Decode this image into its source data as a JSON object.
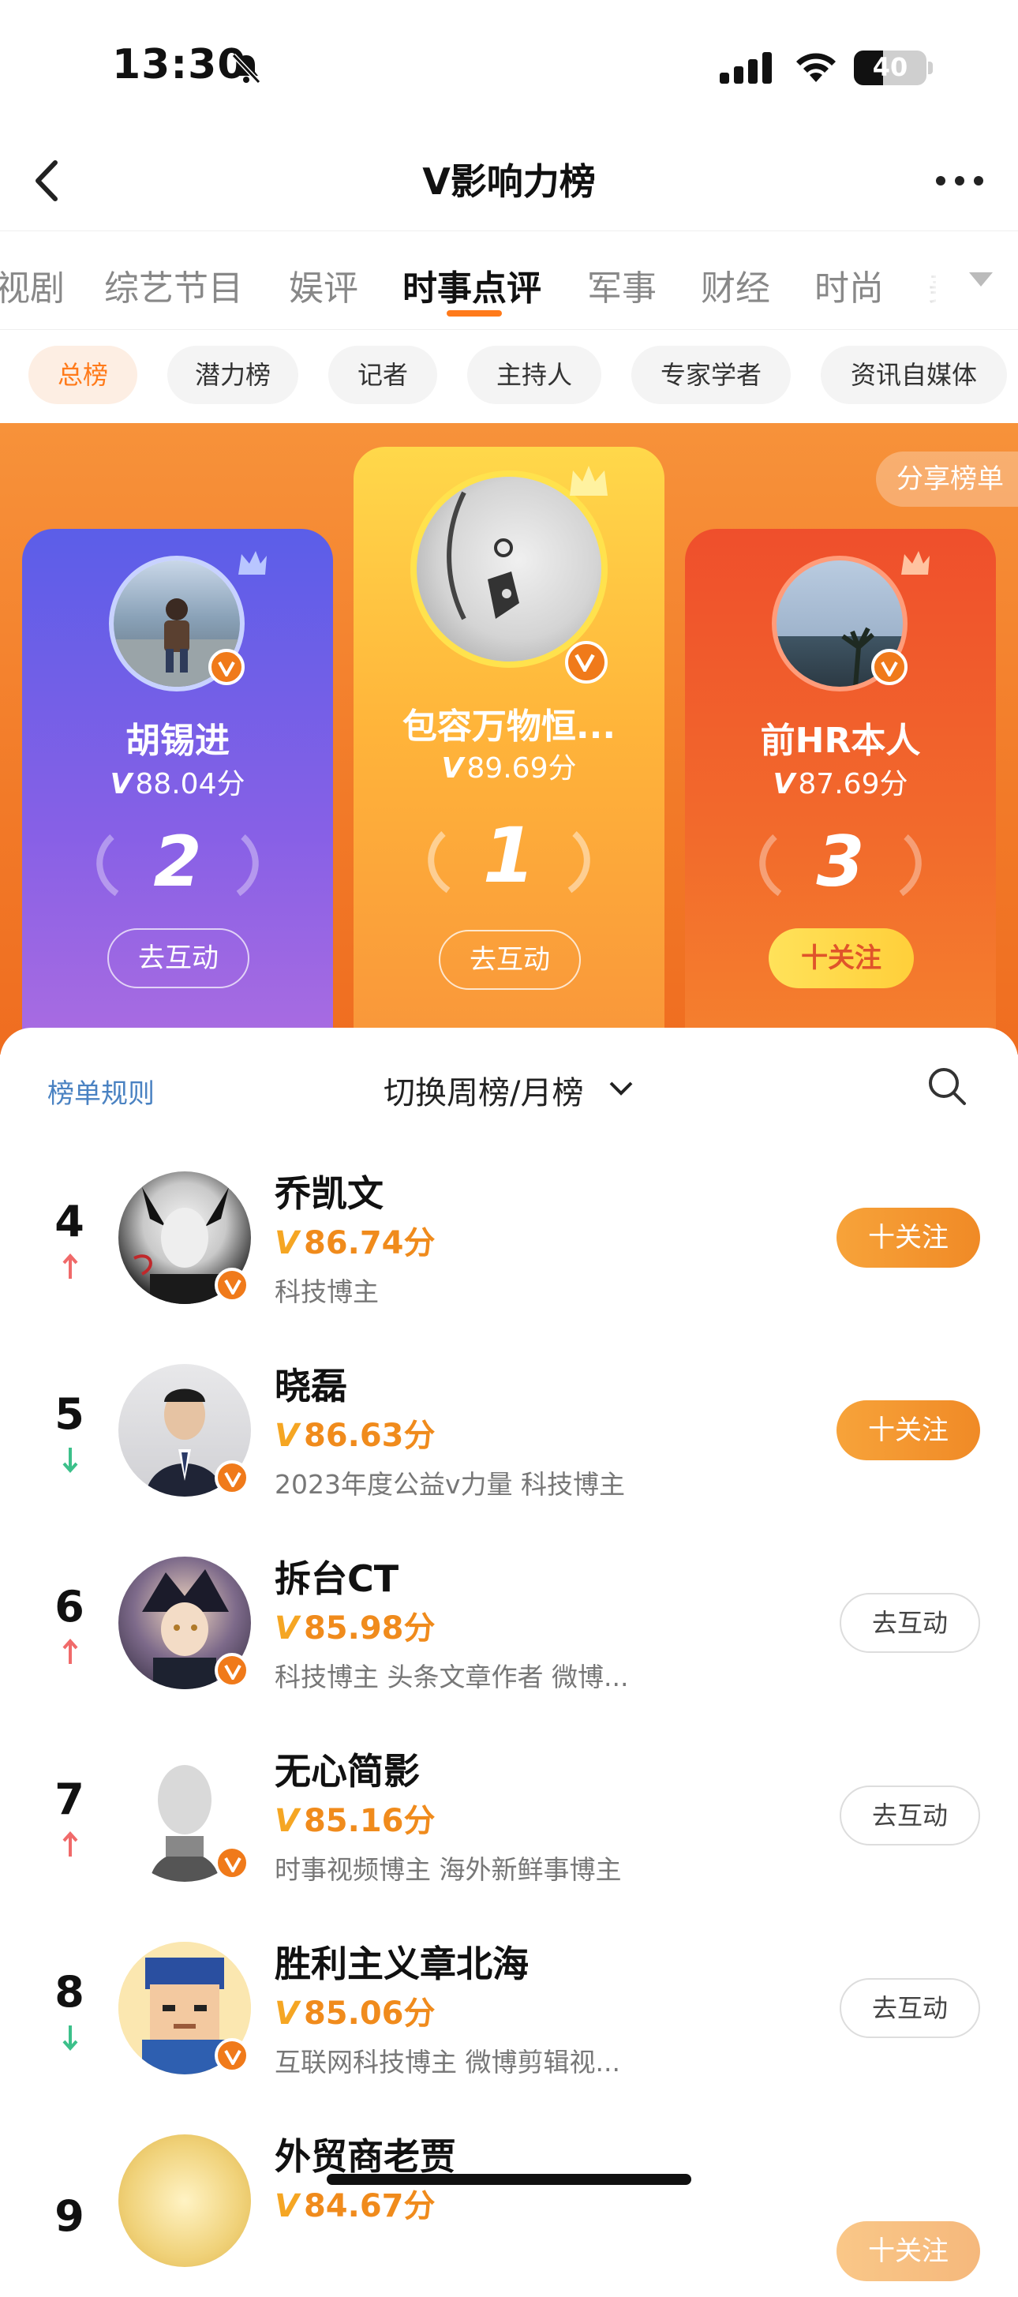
{
  "status_bar": {
    "time": "13:30",
    "battery": "40"
  },
  "nav": {
    "title": "V影响力榜"
  },
  "category_tabs": [
    {
      "label": "视剧",
      "active": false
    },
    {
      "label": "综艺节目",
      "active": false
    },
    {
      "label": "娱评",
      "active": false
    },
    {
      "label": "时事点评",
      "active": true
    },
    {
      "label": "军事",
      "active": false
    },
    {
      "label": "财经",
      "active": false
    },
    {
      "label": "时尚",
      "active": false
    },
    {
      "label": "美",
      "active": false
    }
  ],
  "sub_tabs": [
    {
      "label": "总榜",
      "active": true
    },
    {
      "label": "潜力榜",
      "active": false
    },
    {
      "label": "记者",
      "active": false
    },
    {
      "label": "主持人",
      "active": false
    },
    {
      "label": "专家学者",
      "active": false
    },
    {
      "label": "资讯自媒体",
      "active": false
    }
  ],
  "share_label": "分享榜单",
  "podium": {
    "first": {
      "name": "包容万物恒...",
      "score": "89.69分",
      "rank": "1",
      "button": "去互动"
    },
    "second": {
      "name": "胡锡进",
      "score": "88.04分",
      "rank": "2",
      "button": "去互动"
    },
    "third": {
      "name": "前HR本人",
      "score": "87.69分",
      "rank": "3",
      "button": "十关注"
    }
  },
  "list_header": {
    "rules": "榜单规则",
    "switch": "切换周榜/月榜"
  },
  "list": [
    {
      "rank": "4",
      "trend": "up",
      "name": "乔凯文",
      "score": "86.74分",
      "desc": "科技博主",
      "action": "十关注",
      "action_type": "follow"
    },
    {
      "rank": "5",
      "trend": "down",
      "name": "晓磊",
      "score": "86.63分",
      "desc": "2023年度公益v力量 科技博主",
      "action": "十关注",
      "action_type": "follow"
    },
    {
      "rank": "6",
      "trend": "up",
      "name": "拆台CT",
      "score": "85.98分",
      "desc": "科技博主 头条文章作者 微博...",
      "action": "去互动",
      "action_type": "interact"
    },
    {
      "rank": "7",
      "trend": "up",
      "name": "无心简影",
      "score": "85.16分",
      "desc": "时事视频博主 海外新鲜事博主",
      "action": "去互动",
      "action_type": "interact"
    },
    {
      "rank": "8",
      "trend": "down",
      "name": "胜利主义章北海",
      "score": "85.06分",
      "desc": "互联网科技博主 微博剪辑视...",
      "action": "去互动",
      "action_type": "interact"
    },
    {
      "rank": "9",
      "trend": "none",
      "name": "外贸商老贾",
      "score": "84.67分",
      "desc": "",
      "action": "十关注",
      "action_type": "follow"
    }
  ],
  "colors": {
    "accent": "#ff7a1a",
    "up": "#f06a6a",
    "down": "#3cc08a",
    "link": "#4a82c2"
  }
}
